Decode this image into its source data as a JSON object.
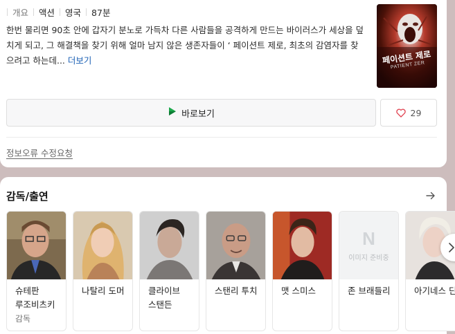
{
  "meta": {
    "overview_label": "개요",
    "genre": "액션",
    "country": "영국",
    "runtime": "87분"
  },
  "synopsis": {
    "text": "한번 물리면 90초 안에 갑자기 분노로 가득차 다른 사람들을 공격하게 만드는 바이러스가 세상을 덮치게 되고, 그 해결책을 찾기 위해 얼마 남지 않은 생존자들이 ‘ 페이션트 제로, 최초의 감염자를 찾으려고 하는데...",
    "more_label": "더보기"
  },
  "poster": {
    "title_kr": "페이션트 제로",
    "title_en": "PATIENT ZER"
  },
  "actions": {
    "watch_label": "바로보기",
    "like_count": "29"
  },
  "report_label": "정보오류 수정요청",
  "cast_section": {
    "title": "감독/출연",
    "people": [
      {
        "name": "슈테판 루조비츠키",
        "role": "감독"
      },
      {
        "name": "나탈리 도머",
        "role": ""
      },
      {
        "name": "클라이브 스탠든",
        "role": ""
      },
      {
        "name": "스탠리 투치",
        "role": ""
      },
      {
        "name": "맷 스미스",
        "role": ""
      },
      {
        "name": "존 브래들리",
        "role": ""
      },
      {
        "name": "아기네스 딘",
        "role": ""
      }
    ],
    "no_image_label": "이미지 준비중"
  },
  "colors": {
    "link": "#1a5fb4",
    "heart": "#e0414f",
    "play_icon": "#1aa84a",
    "backdrop": "#cdbdbd"
  }
}
